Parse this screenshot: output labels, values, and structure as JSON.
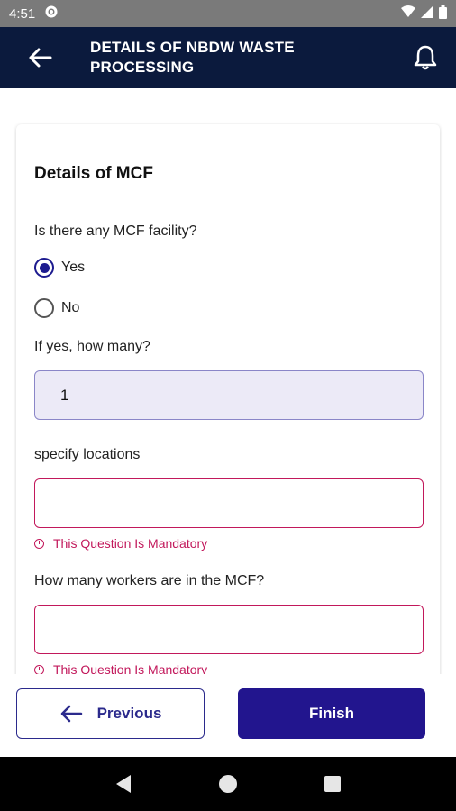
{
  "status_bar": {
    "time": "4:51"
  },
  "app_bar": {
    "title_line1": "DETAILS OF NBDW WASTE",
    "title_line2": "PROCESSING"
  },
  "section": {
    "title": "Details of MCF"
  },
  "questions": [
    {
      "label": "Is there any MCF facility?",
      "options": [
        "Yes",
        "No"
      ],
      "selected": "Yes"
    },
    {
      "label": "If yes, how many?",
      "value": "1"
    },
    {
      "label": "specify locations",
      "value": "",
      "error": "This Question Is Mandatory"
    },
    {
      "label": "How many workers are in the MCF?",
      "value": "",
      "error": "This Question Is Mandatory"
    }
  ],
  "buttons": {
    "previous": "Previous",
    "finish": "Finish"
  },
  "colors": {
    "app_bar": "#0b1a3d",
    "accent": "#22158e",
    "error": "#c2185b",
    "status_bar": "#7a7a7a"
  },
  "icons": [
    "settings-icon",
    "wifi-icon",
    "signal-icon",
    "battery-icon",
    "back-arrow-icon",
    "bell-icon",
    "left-arrow-icon",
    "nav-back-icon",
    "nav-home-icon",
    "nav-recents-icon"
  ]
}
